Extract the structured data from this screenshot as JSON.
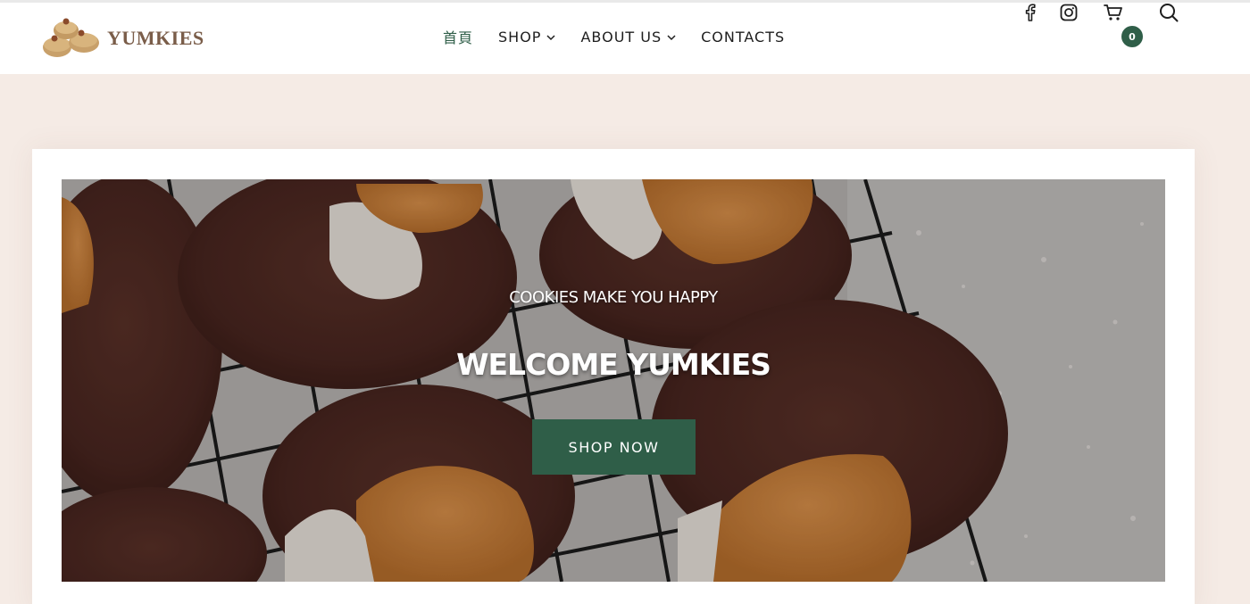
{
  "brand": {
    "name": "YUMKIES"
  },
  "nav": {
    "items": [
      {
        "label": "首頁",
        "has_dropdown": false,
        "active": true
      },
      {
        "label": "SHOP",
        "has_dropdown": true,
        "active": false
      },
      {
        "label": "ABOUT US",
        "has_dropdown": true,
        "active": false
      },
      {
        "label": "CONTACTS",
        "has_dropdown": false,
        "active": false
      }
    ]
  },
  "header_icons": {
    "facebook": "facebook-icon",
    "instagram": "instagram-icon",
    "cart": "cart-icon",
    "search": "search-icon"
  },
  "cart": {
    "count": "0"
  },
  "hero": {
    "eyebrow": "COOKIES MAKE YOU HAPPY",
    "title": "WELCOME YUMKIES",
    "button_label": "SHOP NOW"
  },
  "colors": {
    "accent": "#2f5e48",
    "page_background": "#f5ebe5",
    "brand_text": "#7a5d49"
  }
}
